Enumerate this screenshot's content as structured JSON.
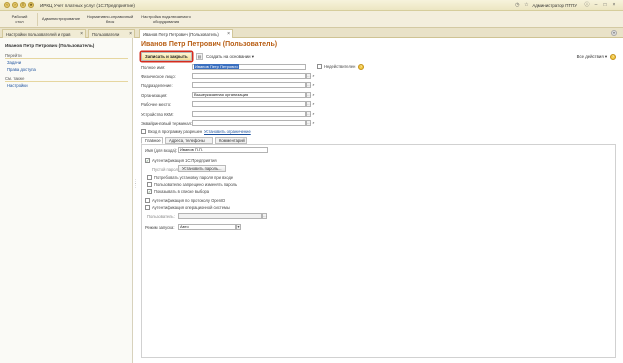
{
  "window": {
    "title": "ИРКЦ Учет платных услуг  (1С:Предприятие)",
    "user": "Администратор ПТПУ"
  },
  "sections": [
    {
      "label": "Рабочий\nстол"
    },
    {
      "label": "Администрирование"
    },
    {
      "label": "Нормативно-справочный\nблок"
    },
    {
      "label": "Настройка подключаемого\nоборудования"
    }
  ],
  "tabs": [
    {
      "label": "Настройки пользователей и прав"
    },
    {
      "label": "Пользователи"
    },
    {
      "label": "Иванов Петр Петрович (Пользователь)"
    }
  ],
  "left_panel": {
    "title": "Иванов Петр Петрович (Пользователь)",
    "group1_title": "Перейти",
    "group1_links": [
      "Задачи",
      "Права доступа"
    ],
    "group2_title": "См. также",
    "group2_links": [
      "Настройки"
    ]
  },
  "form": {
    "title": "Иванов Петр Петрович (Пользователь)",
    "save_close_label": "Записать и закрыть",
    "create_basis_label": "Создать на основании ▾",
    "all_actions_label": "Все действия ▾",
    "help_label": "?",
    "fields": {
      "full_name": {
        "label": "Полное имя:",
        "value": "Иванов Петр Петрович"
      },
      "individual": {
        "label": "Физическое лицо:",
        "value": ""
      },
      "department": {
        "label": "Подразделение:",
        "value": ""
      },
      "organization": {
        "label": "Организация:",
        "value": "Вышеуказанная организация"
      },
      "workplace": {
        "label": "Рабочее место:",
        "value": ""
      },
      "kkm_device": {
        "label": "Устройство ККМ:",
        "value": ""
      },
      "acquiring_terminal": {
        "label": "Эквайринговый терминал:",
        "value": ""
      }
    },
    "invalid_label": "Недействителен",
    "login_allowed_label": "Вход в программу разрешен",
    "set_restriction_link": "Установить ограничение",
    "subtabs": [
      "Главное",
      "Адреса, телефоны",
      "Комментарий"
    ],
    "login_name_label": "Имя (для входа):",
    "login_name_value": "Иванов П.П.",
    "auth_1c_label": "Аутентификация 1С:Предприятия",
    "empty_password_label": "Пустой пароль",
    "set_password_label": "Установить пароль...",
    "require_password_label": "Потребовать установку пароля при входе",
    "forbid_change_label": "Пользователю запрещено изменять пароль",
    "show_in_list_label": "Показывать в списке выбора",
    "openid_label": "Аутентификация по протоколу OpenID",
    "os_auth_label": "Аутентификация операционной системы",
    "os_user_label": "Пользователь:",
    "os_user_value": "",
    "run_mode_label": "Режим запуска:",
    "run_mode_value": "Авто"
  }
}
